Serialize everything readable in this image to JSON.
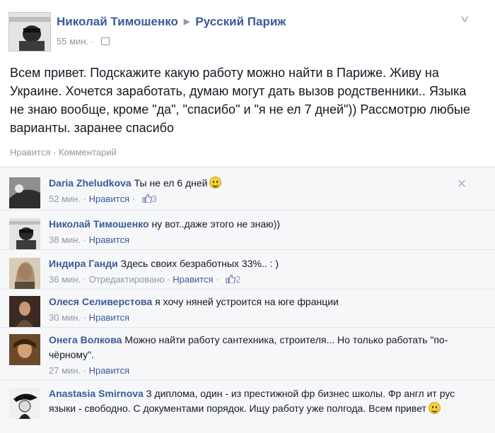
{
  "post": {
    "author": "Николай Тимошенко",
    "group": "Русский Париж",
    "time": "55 мин.",
    "text": "Всем привет. Подскажите какую работу можно найти в Париже. Живу на Украине. Хочется заработать, думаю могут дать вызов родственники.. Языка не знаю вообще, кроме \"да\", \"спасибо\" и \"я не ел 7 дней\")) Рассмотрю любые варианты. заранее спасибо",
    "like_label": "Нравится",
    "comment_label": "Комментарий"
  },
  "comments": [
    {
      "author": "Daria Zheludkova",
      "text": "Ты не ел 6 дней",
      "time": "52 мин.",
      "like": "Нравится",
      "likes": "3"
    },
    {
      "author": "Николай Тимошенко",
      "text": "ну вот..даже этого не знаю))",
      "time": "38 мин.",
      "like": "Нравится"
    },
    {
      "author": "Индира Ганди",
      "text": "Здесь своих безработных 33%.. : )",
      "time": "36 мин.",
      "edited": "Отредактировано",
      "like": "Нравится",
      "likes": "2"
    },
    {
      "author": "Олеся Селиверстова",
      "text": "я хочу няней устроится на юге франции",
      "time": "30 мин.",
      "like": "Нравится"
    },
    {
      "author": "Онега Волкова",
      "text": "Можно найти работу сантехника, строителя... Но только работать \"по-чёрному\".",
      "time": "27 мин.",
      "like": "Нравится"
    },
    {
      "author": "Anastasia Smirnova",
      "text": "3 диплома, один - из престижной фр бизнес школы. Фр англ ит рус языки - свободно. С документами порядок. Ищу работу уже полгода. Всем привет"
    }
  ],
  "icons": {
    "globe": "globe-icon",
    "chevron": "chevron-down-icon",
    "close": "close-icon",
    "thumb": "thumbs-up-icon",
    "smiley": "smiley-icon"
  },
  "colors": {
    "link": "#3b5998",
    "meta": "#9197a3",
    "comments_bg": "#f6f7f9"
  }
}
